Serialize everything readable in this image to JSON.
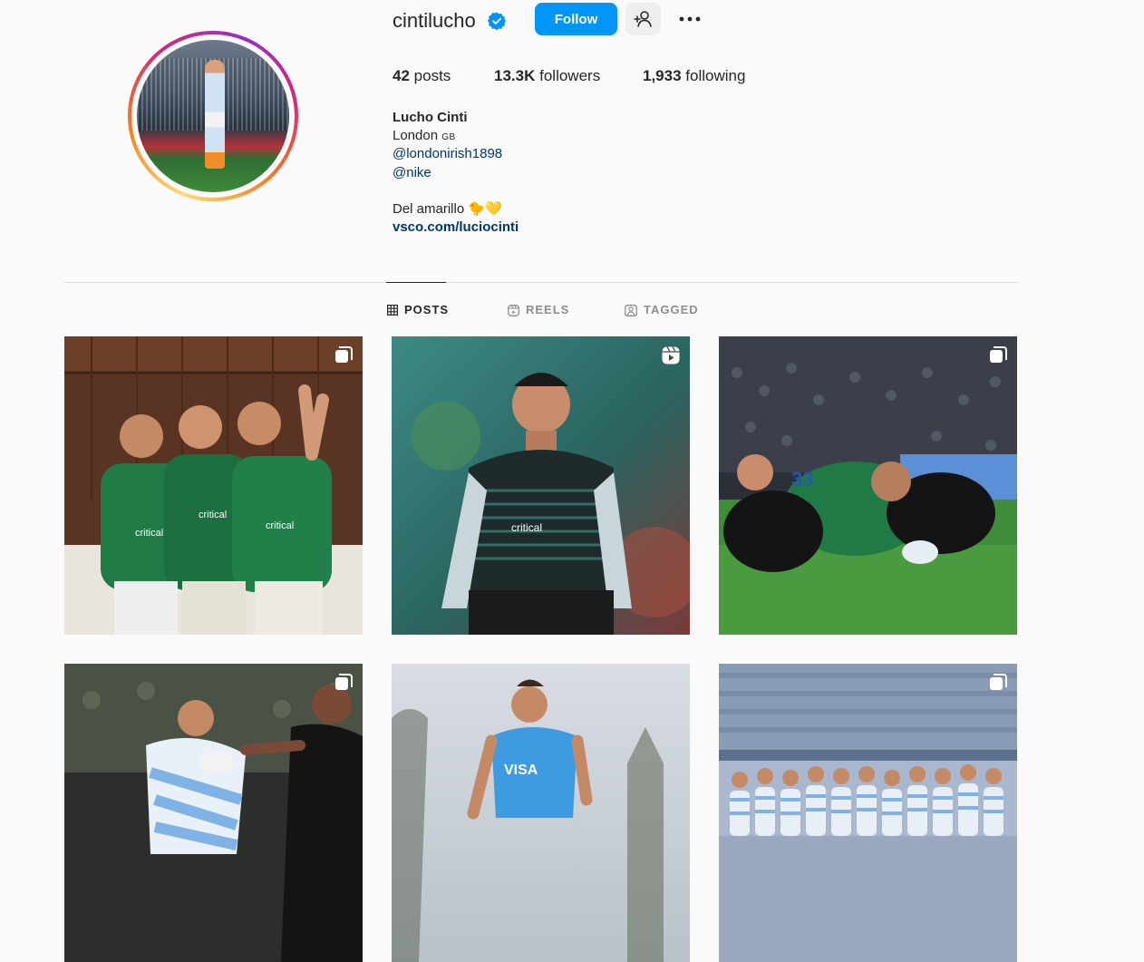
{
  "profile": {
    "username": "cintilucho",
    "verified": true,
    "follow_label": "Follow",
    "stats": {
      "posts_count": "42",
      "posts_label": "posts",
      "followers_count": "13.3K",
      "followers_label": "followers",
      "following_count": "1,933",
      "following_label": "following"
    },
    "full_name": "Lucho Cinti",
    "location": "London",
    "location_flag": "GB",
    "mentions": [
      "@londonirish1898",
      "@nike"
    ],
    "bio_text": "Del amarillo 🐤💛",
    "website": "vsco.com/luciocinti"
  },
  "tabs": [
    {
      "label": "POSTS",
      "icon": "grid-icon",
      "active": true
    },
    {
      "label": "REELS",
      "icon": "reels-icon",
      "active": false
    },
    {
      "label": "TAGGED",
      "icon": "tagged-icon",
      "active": false
    }
  ],
  "posts": [
    {
      "type": "carousel",
      "badge_icon": "carousel-icon"
    },
    {
      "type": "reel",
      "badge_icon": "reel-icon"
    },
    {
      "type": "carousel",
      "badge_icon": "carousel-icon"
    },
    {
      "type": "carousel",
      "badge_icon": "carousel-icon"
    },
    {
      "type": "image",
      "badge_icon": ""
    },
    {
      "type": "carousel",
      "badge_icon": "carousel-icon"
    }
  ],
  "colors": {
    "accent": "#0095f6",
    "link": "#00376b",
    "muted": "#8e8e8e",
    "verified_badge": "#0095f6"
  }
}
